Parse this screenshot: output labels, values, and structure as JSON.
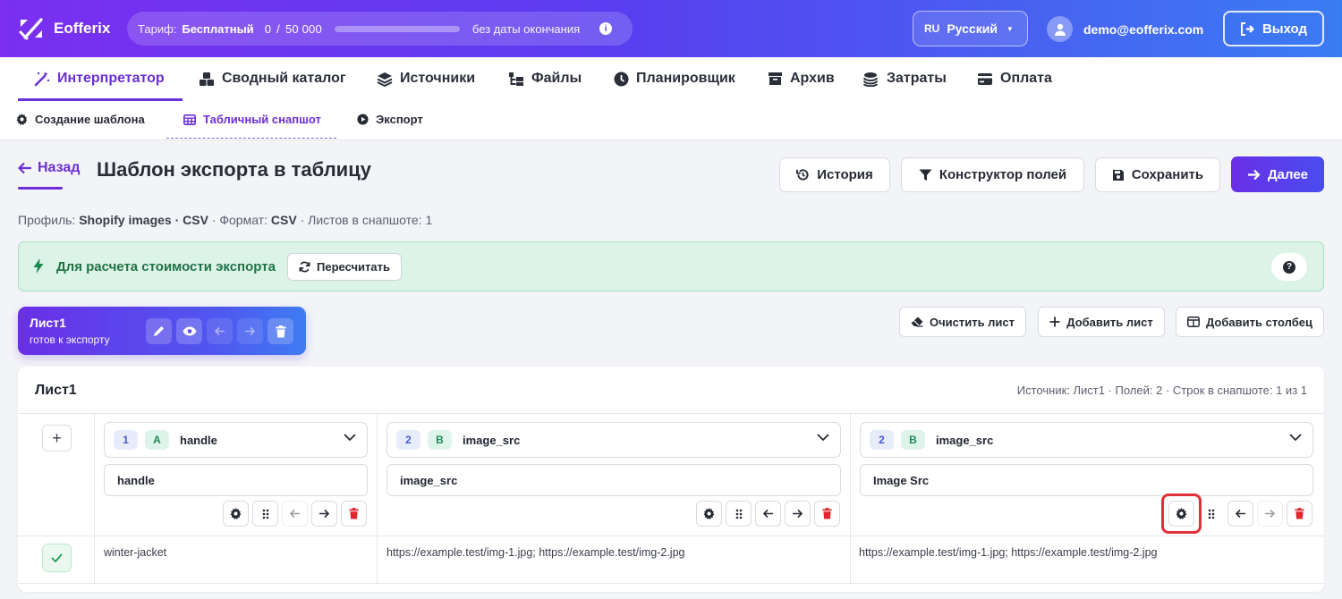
{
  "topbar": {
    "brand": "Eofferix",
    "plan_label": "Тариф:",
    "plan_name": "Бесплатный",
    "plan_used": "0",
    "plan_sep": "/",
    "plan_total": "50 000",
    "plan_progress": 0,
    "plan_expiry": "без даты окончания",
    "lang_code": "RU",
    "lang_name": "Русский",
    "user_email": "demo@eofferix.com",
    "logout_label": "Выход"
  },
  "main_nav": [
    {
      "label": "Интерпретатор",
      "icon": "magic-wand-icon",
      "active": true
    },
    {
      "label": "Сводный каталог",
      "icon": "boxes-icon",
      "active": false
    },
    {
      "label": "Источники",
      "icon": "layers-icon",
      "active": false
    },
    {
      "label": "Файлы",
      "icon": "folder-tree-icon",
      "active": false
    },
    {
      "label": "Планировщик",
      "icon": "clock-icon",
      "active": false
    },
    {
      "label": "Архив",
      "icon": "archive-icon",
      "active": false
    },
    {
      "label": "Затраты",
      "icon": "coins-icon",
      "active": false
    },
    {
      "label": "Оплата",
      "icon": "credit-card-icon",
      "active": false
    }
  ],
  "sub_nav": [
    {
      "label": "Создание шаблона",
      "icon": "gear-icon",
      "active": false
    },
    {
      "label": "Табличный снапшот",
      "icon": "table-icon",
      "active": true
    },
    {
      "label": "Экспорт",
      "icon": "play-circle-icon",
      "active": false
    }
  ],
  "page": {
    "back_label": "Назад",
    "title": "Шаблон экспорта в таблицу",
    "history_label": "История",
    "constructor_label": "Конструктор полей",
    "save_label": "Сохранить",
    "next_label": "Далее",
    "meta": {
      "profile_label": "Профиль:",
      "profile_value": "Shopify images · CSV",
      "format_label": "· Формат:",
      "format_value": "CSV",
      "sheets_text": "· Листов в снапшоте: 1"
    }
  },
  "banner": {
    "text": "Для расчета стоимости экспорта",
    "recalc_label": "Пересчитать",
    "help_glyph": "?",
    "color": "#dcf3e7"
  },
  "sheet_tab": {
    "name": "Лист1",
    "status": "готов к экспорту"
  },
  "sheet_actions": {
    "clear_label": "Очистить лист",
    "add_sheet_label": "Добавить лист",
    "add_column_label": "Добавить столбец"
  },
  "table": {
    "title": "Лист1",
    "info": "Источник: Лист1 · Полей: 2 · Строк в снапшоте: 1 из 1",
    "add_glyph": "+",
    "columns": [
      {
        "index": "1",
        "letter": "A",
        "field": "handle",
        "name": "handle"
      },
      {
        "index": "2",
        "letter": "B",
        "field": "image_src",
        "name": "image_src"
      },
      {
        "index": "2",
        "letter": "B",
        "field": "image_src",
        "name": "Image Src"
      }
    ],
    "rows": [
      {
        "status": "ok",
        "cells": [
          "winter-jacket",
          "https://example.test/img-1.jpg; https://example.test/img-2.jpg",
          "https://example.test/img-1.jpg; https://example.test/img-2.jpg"
        ]
      }
    ]
  },
  "colors": {
    "accent": "#6b2fd8",
    "danger": "#e0262e",
    "success": "#1f9d55"
  }
}
